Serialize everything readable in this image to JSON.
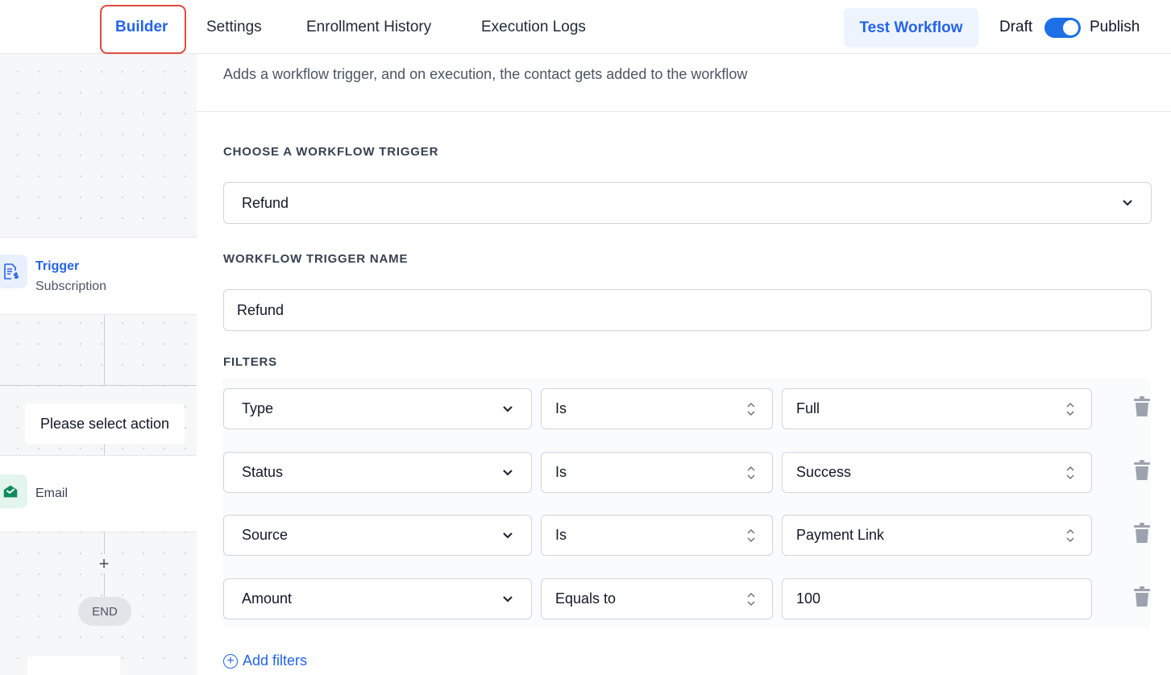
{
  "nav": {
    "tabs": [
      {
        "label": "Builder"
      },
      {
        "label": "Settings"
      },
      {
        "label": "Enrollment History"
      },
      {
        "label": "Execution Logs"
      }
    ],
    "test_workflow": "Test Workflow",
    "draft_label": "Draft",
    "publish_label": "Publish",
    "publish_toggle_on": true
  },
  "canvas": {
    "trigger_node": {
      "title": "Trigger",
      "subtitle": "Subscription",
      "icon": "invoice-dollar-icon"
    },
    "action_placeholder": "Please select action",
    "email_node": {
      "title": "Email",
      "icon": "envelope-open-icon"
    },
    "add_step": "+",
    "end_label": "END"
  },
  "panel": {
    "description": "Adds a workflow trigger, and on execution, the contact gets added to the workflow",
    "choose_trigger_label": "CHOOSE A WORKFLOW TRIGGER",
    "trigger_selected": "Refund",
    "trigger_name_label": "WORKFLOW TRIGGER NAME",
    "trigger_name_value": "Refund",
    "filters_label": "FILTERS",
    "filters": [
      {
        "field": "Type",
        "operator": "Is",
        "value": "Full"
      },
      {
        "field": "Status",
        "operator": "Is",
        "value": "Success"
      },
      {
        "field": "Source",
        "operator": "Is",
        "value": "Payment Link"
      },
      {
        "field": "Amount",
        "operator": "Equals to",
        "value": "100"
      }
    ],
    "add_filters": "Add filters"
  },
  "colors": {
    "accent": "#2563eb",
    "highlight": "#dc4b3e",
    "email_green": "#0f8a5f"
  }
}
